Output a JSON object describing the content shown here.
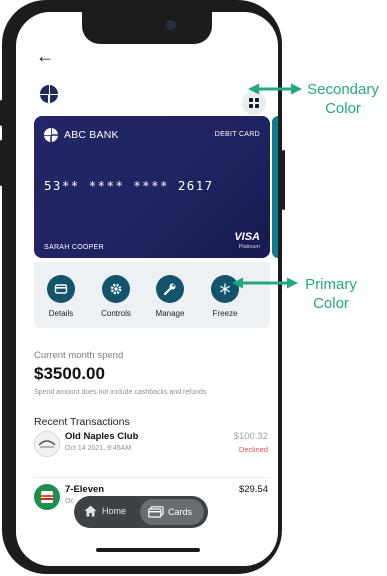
{
  "header": {
    "back_glyph": "←",
    "logo_icon": "bank-logo-icon",
    "menu_icon": "grid-icon"
  },
  "card": {
    "bank_name": "ABC BANK",
    "type": "DEBIT CARD",
    "number": "53** **** **** 2617",
    "holder": "SARAH COOPER",
    "network": "VISA",
    "tier": "Platinum",
    "colors": {
      "card": "#232767",
      "next_card": "#137b8b"
    }
  },
  "actions": [
    {
      "label": "Details",
      "icon": "card-icon"
    },
    {
      "label": "Controls",
      "icon": "gear-icon"
    },
    {
      "label": "Manage",
      "icon": "wrench-icon"
    },
    {
      "label": "Freeze",
      "icon": "snowflake-icon"
    }
  ],
  "spend": {
    "label": "Current month spend",
    "amount": "$3500.00",
    "note": "Spend amount does not include cashbacks and refunds"
  },
  "recent_title": "Recent Transactions",
  "transactions": [
    {
      "name": "Old Naples Club",
      "date": "Oct 14 2021, 9:45AM",
      "amount": "$100.32",
      "status": "Declined"
    },
    {
      "name": "7-Eleven",
      "date": "Oc",
      "amount": "$29.54",
      "status": ""
    }
  ],
  "nav": {
    "home_label": "Home",
    "cards_label": "Cards"
  },
  "annotations": {
    "secondary": "Secondary Color",
    "primary": "Primary Color",
    "color": "#25a87f"
  },
  "colors": {
    "primary": "#13546c",
    "secondary": "#e8edf1",
    "declined": "#d9534f"
  }
}
